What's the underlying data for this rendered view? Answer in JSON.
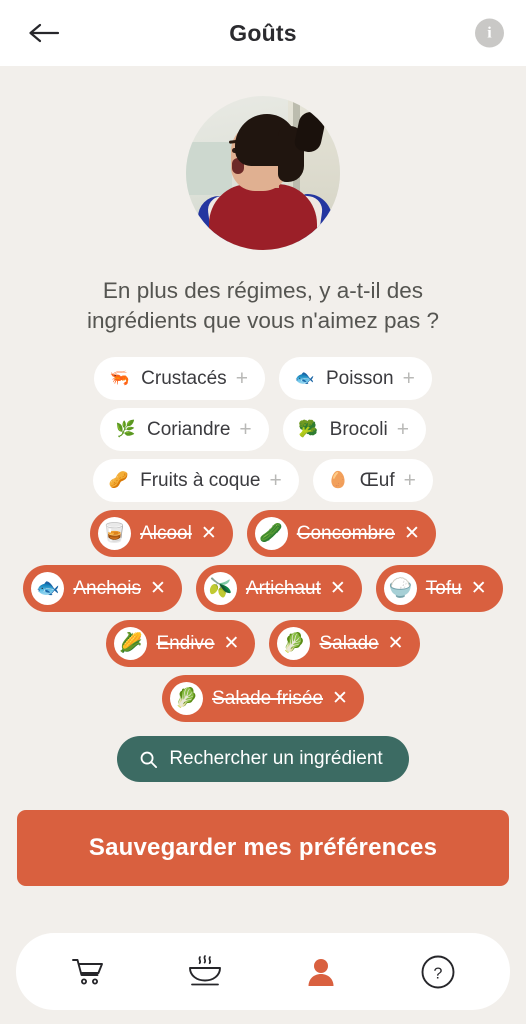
{
  "header": {
    "title": "Goûts",
    "back_icon": "arrow-left-icon",
    "info_icon": "info-icon",
    "info_label": "i"
  },
  "avatar": {
    "alt": "profile-photo-woman"
  },
  "question": "En plus des régimes, y a-t-il des ingrédients que vous n'aimez pas ?",
  "chips": {
    "add_symbol": "+",
    "remove_symbol": "✕",
    "rows": [
      [
        {
          "label": "Crustacés",
          "emoji": "🦐",
          "icon": "shrimp-icon",
          "selected": false
        },
        {
          "label": "Poisson",
          "emoji": "🐟",
          "icon": "fish-icon",
          "selected": false
        }
      ],
      [
        {
          "label": "Coriandre",
          "emoji": "🌿",
          "icon": "herb-icon",
          "selected": false
        },
        {
          "label": "Brocoli",
          "emoji": "🥦",
          "icon": "broccoli-icon",
          "selected": false
        }
      ],
      [
        {
          "label": "Fruits à coque",
          "emoji": "🥜",
          "icon": "nuts-icon",
          "selected": false
        },
        {
          "label": "Œuf",
          "emoji": "🥚",
          "icon": "egg-icon",
          "selected": false
        }
      ],
      [
        {
          "label": "Alcool",
          "emoji": "🥃",
          "icon": "alcohol-glass-icon",
          "selected": true
        },
        {
          "label": "Concombre",
          "emoji": "🥒",
          "icon": "cucumber-icon",
          "selected": true
        }
      ],
      [
        {
          "label": "Anchois",
          "emoji": "🐟",
          "icon": "anchovy-icon",
          "selected": true
        },
        {
          "label": "Artichaut",
          "emoji": "🫒",
          "icon": "artichoke-icon",
          "selected": true
        },
        {
          "label": "Tofu",
          "emoji": "🍚",
          "icon": "tofu-icon",
          "selected": true
        }
      ],
      [
        {
          "label": "Endive",
          "emoji": "🌽",
          "icon": "endive-icon",
          "selected": true
        },
        {
          "label": "Salade",
          "emoji": "🥬",
          "icon": "salad-icon",
          "selected": true
        }
      ],
      [
        {
          "label": "Salade frisée",
          "emoji": "🥬",
          "icon": "curly-salad-icon",
          "selected": true
        }
      ]
    ]
  },
  "search": {
    "label": "Rechercher un ingrédient",
    "icon": "search-icon"
  },
  "save": {
    "label": "Sauvegarder mes préférences"
  },
  "bottom_nav": {
    "items": [
      {
        "icon": "shopping-cart-icon",
        "active": false
      },
      {
        "icon": "soup-bowl-icon",
        "active": false
      },
      {
        "icon": "person-icon",
        "active": true
      },
      {
        "icon": "help-circle-icon",
        "active": false
      }
    ]
  },
  "colors": {
    "background": "#f2efeb",
    "accent_orange": "#d9603f",
    "search_teal": "#3c6b63",
    "text_dark": "#2b2b2f",
    "text_muted": "#555551",
    "white": "#ffffff"
  }
}
